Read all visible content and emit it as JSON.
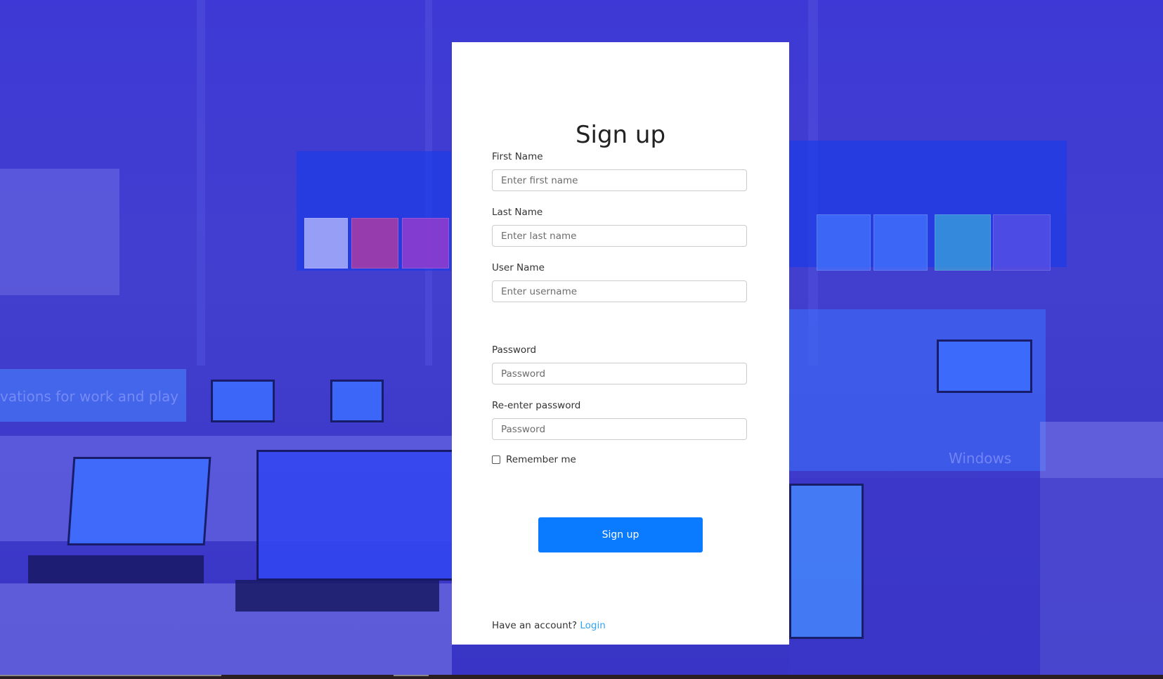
{
  "page": {
    "background_tint": "#2f2ad4",
    "background_banner_text": "vations for work and play",
    "background_sign_text": "Windows"
  },
  "form": {
    "title": "Sign up",
    "fields": {
      "first_name": {
        "label": "First Name",
        "placeholder": "Enter first name"
      },
      "last_name": {
        "label": "Last Name",
        "placeholder": "Enter last name"
      },
      "username": {
        "label": "User Name",
        "placeholder": "Enter username"
      },
      "password": {
        "label": "Password",
        "placeholder": "Password"
      },
      "confirm_password": {
        "label": "Re-enter password",
        "placeholder": "Password"
      }
    },
    "remember_label": "Remember me",
    "remember_checked": false,
    "submit_label": "Sign up",
    "footer_text": "Have an account?",
    "footer_link": "Login"
  },
  "colors": {
    "button": "#0a7aff",
    "link": "#2ea3f2",
    "card": "#ffffff"
  }
}
